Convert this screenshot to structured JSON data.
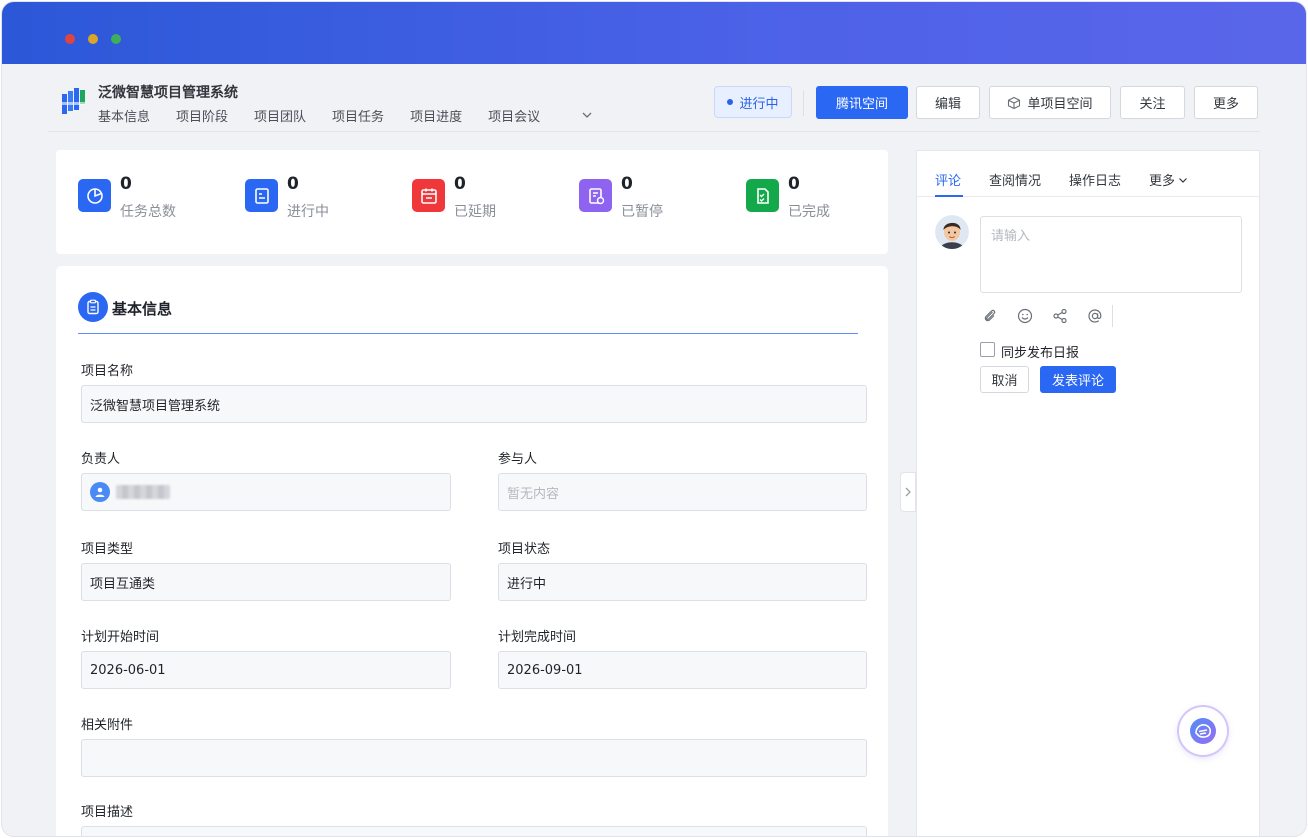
{
  "header": {
    "app_title": "泛微智慧项目管理系统",
    "nav": [
      "基本信息",
      "项目阶段",
      "项目团队",
      "项目任务",
      "项目进度",
      "项目会议"
    ],
    "status": "进行中",
    "buttons": {
      "tencent_space": "腾讯空间",
      "edit": "编辑",
      "single_project_space": "单项目空间",
      "follow": "关注",
      "more": "更多"
    }
  },
  "stats": [
    {
      "value": "0",
      "label": "任务总数",
      "color": "#2a67f2",
      "icon": "pie-chart-icon"
    },
    {
      "value": "0",
      "label": "进行中",
      "color": "#2a67f2",
      "icon": "document-icon"
    },
    {
      "value": "0",
      "label": "已延期",
      "color": "#f0373a",
      "icon": "calendar-icon"
    },
    {
      "value": "0",
      "label": "已暂停",
      "color": "#8d63ef",
      "icon": "paused-document-icon"
    },
    {
      "value": "0",
      "label": "已完成",
      "color": "#13a84a",
      "icon": "checklist-icon"
    }
  ],
  "basic_info": {
    "title": "基本信息",
    "fields": {
      "project_name": {
        "label": "项目名称",
        "value": "泛微智慧项目管理系统"
      },
      "owner": {
        "label": "负责人"
      },
      "participants": {
        "label": "参与人",
        "placeholder": "暂无内容"
      },
      "project_type": {
        "label": "项目类型",
        "value": "项目互通类"
      },
      "project_status": {
        "label": "项目状态",
        "value": "进行中"
      },
      "plan_start": {
        "label": "计划开始时间",
        "value": "2026-06-01"
      },
      "plan_end": {
        "label": "计划完成时间",
        "value": "2026-09-01"
      },
      "attachments": {
        "label": "相关附件",
        "value": ""
      },
      "description": {
        "label": "项目描述"
      }
    }
  },
  "side_panel": {
    "tabs": [
      "评论",
      "查阅情况",
      "操作日志",
      "更多"
    ],
    "comment_placeholder": "请输入",
    "sync_daily_label": "同步发布日报",
    "cancel_label": "取消",
    "submit_label": "发表评论",
    "toolbar_icons": [
      "paperclip-icon",
      "smile-icon",
      "share-icon",
      "at-icon"
    ]
  },
  "colors": {
    "primary": "#2a67f2",
    "titlebar_start": "#2b58d8",
    "titlebar_end": "#5a66ea"
  }
}
